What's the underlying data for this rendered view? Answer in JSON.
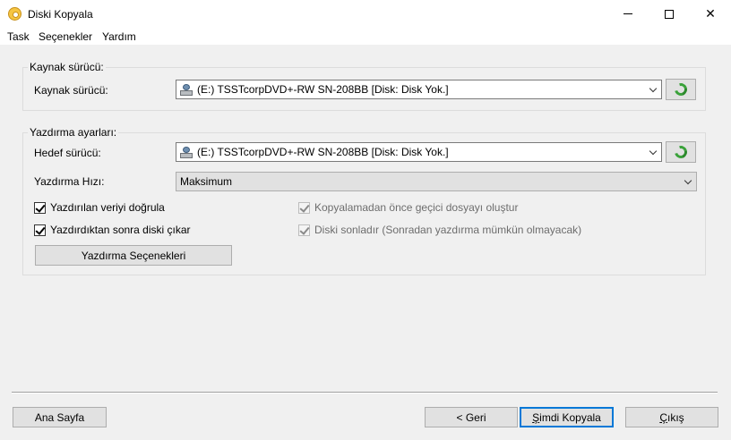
{
  "window": {
    "title": "Diski Kopyala",
    "app_icon": "disc-icon",
    "controls": [
      "minimize-icon",
      "maximize-icon",
      "close-icon"
    ],
    "close_glyph": "✕"
  },
  "menu": {
    "items": [
      "Task",
      "Seçenekler",
      "Yardım"
    ]
  },
  "source_group": {
    "title": "Kaynak sürücü:",
    "label": "Kaynak sürücü:",
    "selected": "(E:) TSSTcorpDVD+-RW SN-208BB [Disk: Disk Yok.]",
    "icon": "drive-icon",
    "refresh_icon": "refresh-icon"
  },
  "write_group": {
    "title": "Yazdırma ayarları:",
    "target_label": "Hedef sürücü:",
    "target_selected": "(E:) TSSTcorpDVD+-RW SN-208BB [Disk: Disk Yok.]",
    "speed_label": "Yazdırma Hızı:",
    "speed_selected": "Maksimum",
    "checkboxes_left": [
      {
        "label": "Yazdırılan veriyi doğrula",
        "checked": true,
        "enabled": true
      },
      {
        "label": "Yazdırdıktan sonra diski çıkar",
        "checked": true,
        "enabled": true
      }
    ],
    "checkboxes_right": [
      {
        "label": "Kopyalamadan önce geçici dosyayı oluştur",
        "checked": true,
        "enabled": false
      },
      {
        "label": "Diski sonladır (Sonradan yazdırma mümkün olmayacak)",
        "checked": true,
        "enabled": false
      }
    ],
    "options_button": "Yazdırma Seçenekleri"
  },
  "footer": {
    "home_button": "Ana Sayfa",
    "back_button": "< Geri",
    "copy_button_accel": "Ş",
    "copy_button_rest": "imdi Kopyala",
    "exit_button_accel": "Ç",
    "exit_button_rest": "ıkış"
  },
  "colors": {
    "accent": "#0078d7",
    "refresh_green": "#3aa23a"
  }
}
